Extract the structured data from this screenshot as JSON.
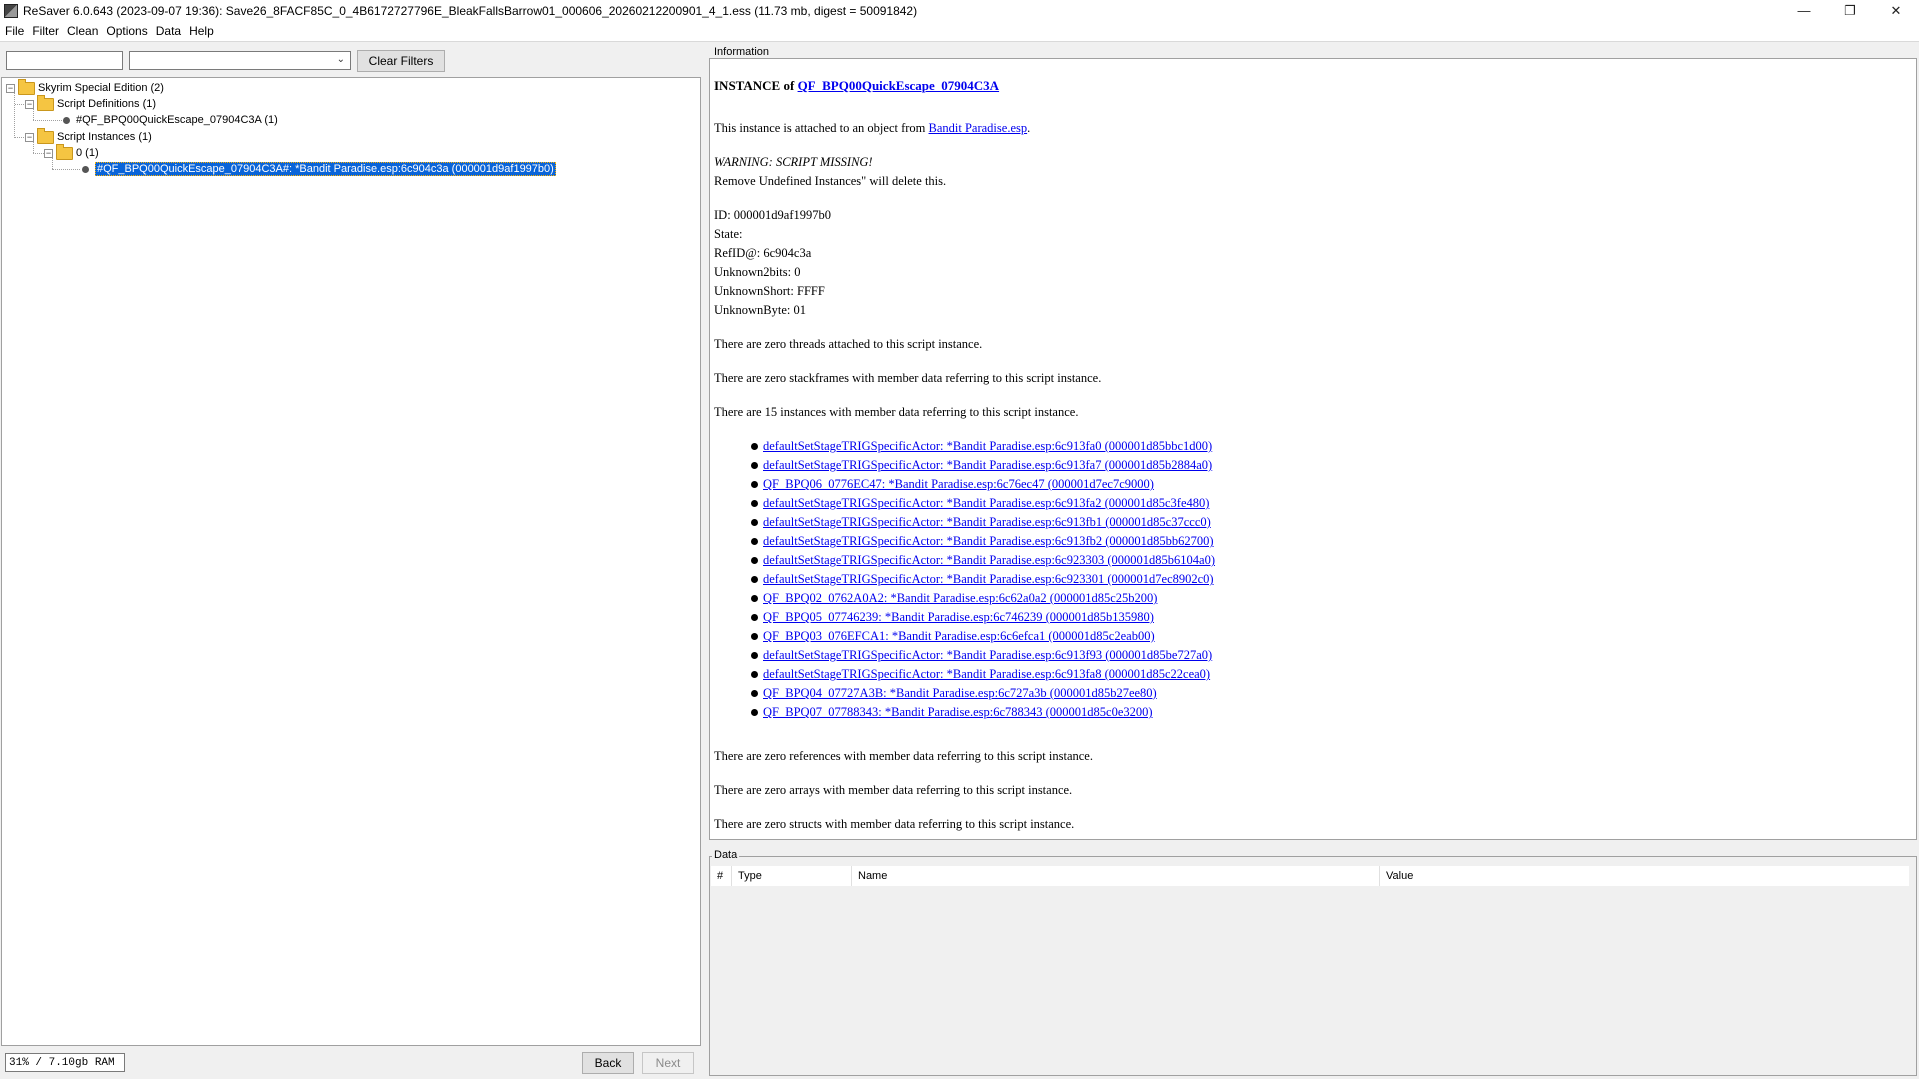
{
  "window": {
    "title": "ReSaver 6.0.643 (2023-09-07 19:36): Save26_8FACF85C_0_4B6172727796E_BleakFallsBarrow01_000606_20260212200901_4_1.ess (11.73 mb, digest = 50091842)",
    "minimize": "—",
    "maximize": "❐",
    "close": "✕"
  },
  "menu": [
    "File",
    "Filter",
    "Clean",
    "Options",
    "Data",
    "Help"
  ],
  "filters": {
    "text_value": "",
    "select_value": "",
    "clear_label": "Clear Filters"
  },
  "tree": {
    "root": "Skyrim Special Edition (2)",
    "script_definitions": "Script Definitions (1)",
    "definition_item": "#QF_BPQ00QuickEscape_07904C3A (1)",
    "script_instances": "Script Instances (1)",
    "instance_group": "0 (1)",
    "selected_instance": "#QF_BPQ00QuickEscape_07904C3A#: *Bandit Paradise.esp:6c904c3a (000001d9af1997b0)"
  },
  "status": {
    "memory": "31% / 7.10gb RAM",
    "back_label": "Back",
    "next_label": "Next"
  },
  "information": {
    "group_label": "Information",
    "title_prefix": "INSTANCE of ",
    "title_link": "QF_BPQ00QuickEscape_07904C3A",
    "attached_prefix": "This instance is attached to an object from ",
    "attached_link": "Bandit Paradise.esp",
    "attached_suffix": ".",
    "warning": "WARNING: SCRIPT MISSING!",
    "remove_note": "Remove Undefined Instances\" will delete this.",
    "fields": [
      "ID: 000001d9af1997b0",
      "State:",
      "RefID@: 6c904c3a",
      "Unknown2bits: 0",
      "UnknownShort: FFFF",
      "UnknownByte: 01"
    ],
    "threads": "There are zero threads attached to this script instance.",
    "stackframes": "There are zero stackframes with member data referring to this script instance.",
    "instances_count": "There are 15 instances with member data referring to this script instance.",
    "instances": [
      "defaultSetStageTRIGSpecificActor: *Bandit Paradise.esp:6c913fa0 (000001d85bbc1d00)",
      "defaultSetStageTRIGSpecificActor: *Bandit Paradise.esp:6c913fa7 (000001d85b2884a0)",
      "QF_BPQ06_0776EC47: *Bandit Paradise.esp:6c76ec47 (000001d7ec7c9000)",
      "defaultSetStageTRIGSpecificActor: *Bandit Paradise.esp:6c913fa2 (000001d85c3fe480)",
      "defaultSetStageTRIGSpecificActor: *Bandit Paradise.esp:6c913fb1 (000001d85c37ccc0)",
      "defaultSetStageTRIGSpecificActor: *Bandit Paradise.esp:6c913fb2 (000001d85bb62700)",
      "defaultSetStageTRIGSpecificActor: *Bandit Paradise.esp:6c923303 (000001d85b6104a0)",
      "defaultSetStageTRIGSpecificActor: *Bandit Paradise.esp:6c923301 (000001d7ec8902c0)",
      "QF_BPQ02_0762A0A2: *Bandit Paradise.esp:6c62a0a2 (000001d85c25b200)",
      "QF_BPQ05_07746239: *Bandit Paradise.esp:6c746239 (000001d85b135980)",
      "QF_BPQ03_076EFCA1: *Bandit Paradise.esp:6c6efca1 (000001d85c2eab00)",
      "defaultSetStageTRIGSpecificActor: *Bandit Paradise.esp:6c913f93 (000001d85be727a0)",
      "defaultSetStageTRIGSpecificActor: *Bandit Paradise.esp:6c913fa8 (000001d85c22cea0)",
      "QF_BPQ04_07727A3B: *Bandit Paradise.esp:6c727a3b (000001d85b27ee80)",
      "QF_BPQ07_07788343: *Bandit Paradise.esp:6c788343 (000001d85c0e3200)"
    ],
    "references": "There are zero references with member data referring to this script instance.",
    "arrays": "There are zero arrays with member data referring to this script instance.",
    "structs": "There are zero structs with member data referring to this script instance."
  },
  "data_panel": {
    "group_label": "Data",
    "columns": [
      "#",
      "Type",
      "Name",
      "Value"
    ]
  }
}
